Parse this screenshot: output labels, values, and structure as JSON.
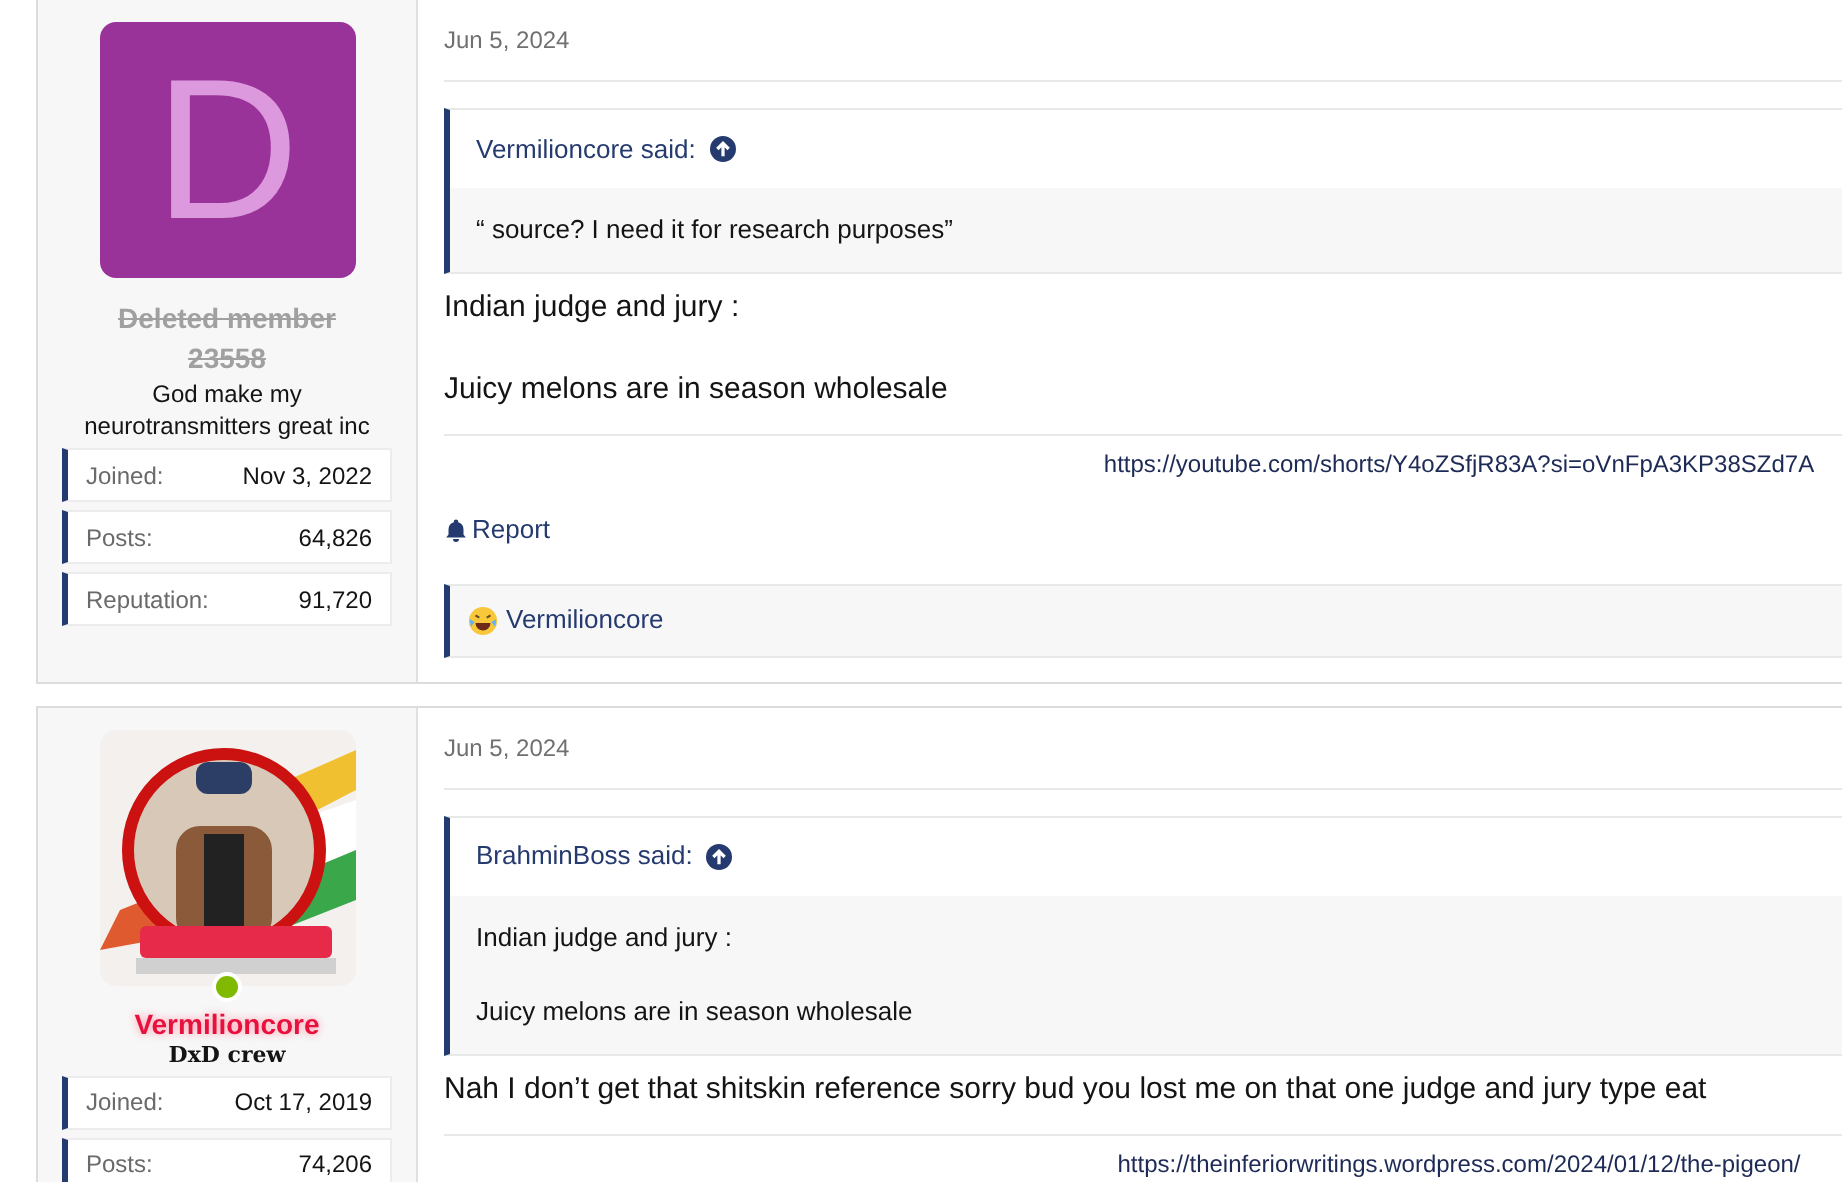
{
  "posts": [
    {
      "author": {
        "avatar": {
          "kind": "letter",
          "letter": "D"
        },
        "name_lines": [
          "Deleted member",
          "23558"
        ],
        "deleted": true,
        "online": false,
        "title": "God make my neurotransmitters great inc",
        "stats": [
          {
            "label": "Joined:",
            "value": "Nov 3, 2022"
          },
          {
            "label": "Posts:",
            "value": "64,826"
          },
          {
            "label": "Reputation:",
            "value": "91,720"
          }
        ]
      },
      "date": "Jun 5, 2024",
      "quote": {
        "author": "Vermilioncore said:",
        "lines": [
          "“ source? I need it for research purposes”"
        ]
      },
      "body": [
        "Indian judge and jury :",
        "Juicy melons are in season wholesale"
      ],
      "signature_link": "https://youtube.com/shorts/Y4oZSfjR83A?si=oVnFpA3KP38SZd7A",
      "actions": [
        "Report"
      ],
      "reactions": [
        {
          "user": "Vermilioncore"
        }
      ]
    },
    {
      "author": {
        "avatar": {
          "kind": "picture"
        },
        "name_lines": [
          "Vermilioncore"
        ],
        "deleted": false,
        "online": true,
        "title": "DxD crew",
        "stats": [
          {
            "label": "Joined:",
            "value": "Oct 17, 2019"
          },
          {
            "label": "Posts:",
            "value": "74,206"
          }
        ]
      },
      "date": "Jun 5, 2024",
      "quote": {
        "author": "BrahminBoss said:",
        "lines": [
          "Indian judge and jury :",
          "Juicy melons are in season wholesale"
        ]
      },
      "body": [
        "Nah I don’t get that shitskin reference sorry bud you lost me on that one judge and jury type eat"
      ],
      "signature_link": "https://theinferiorwritings.wordpress.com/2024/01/12/the-pigeon/"
    }
  ]
}
